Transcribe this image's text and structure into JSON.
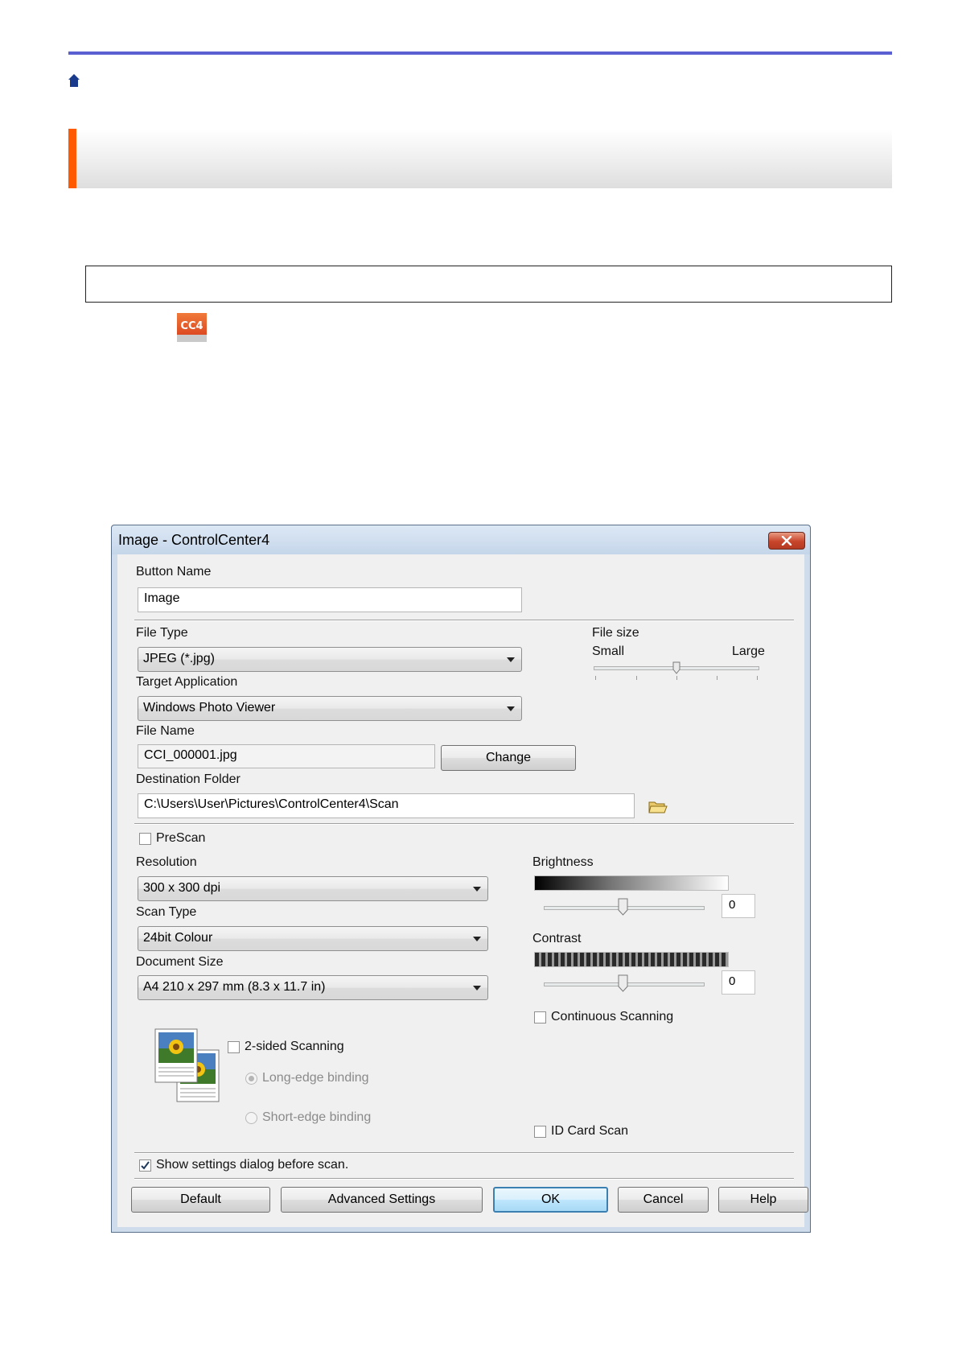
{
  "dialog": {
    "title": "Image - ControlCenter4",
    "button_name_label": "Button Name",
    "button_name_value": "Image",
    "file_type_label": "File Type",
    "file_type_value": "JPEG (*.jpg)",
    "file_size_label": "File size",
    "file_size_small": "Small",
    "file_size_large": "Large",
    "target_app_label": "Target Application",
    "target_app_value": "Windows Photo Viewer",
    "file_name_label": "File Name",
    "file_name_value": "CCI_000001.jpg",
    "change_button": "Change",
    "dest_folder_label": "Destination Folder",
    "dest_folder_value": "C:\\Users\\User\\Pictures\\ControlCenter4\\Scan",
    "prescan_label": "PreScan",
    "resolution_label": "Resolution",
    "resolution_value": "300 x 300 dpi",
    "scan_type_label": "Scan Type",
    "scan_type_value": "24bit Colour",
    "doc_size_label": "Document Size",
    "doc_size_value": "A4 210 x 297 mm (8.3 x 11.7 in)",
    "brightness_label": "Brightness",
    "brightness_value": "0",
    "contrast_label": "Contrast",
    "contrast_value": "0",
    "continuous_label": "Continuous Scanning",
    "two_sided_label": "2-sided Scanning",
    "long_edge_label": "Long-edge binding",
    "short_edge_label": "Short-edge binding",
    "id_card_label": "ID Card Scan",
    "show_settings_label": "Show settings dialog before scan.",
    "show_settings_checked": true,
    "buttons": {
      "default": "Default",
      "advanced": "Advanced Settings",
      "ok": "OK",
      "cancel": "Cancel",
      "help": "Help"
    }
  },
  "icons": {
    "cc4_label": "CC4"
  },
  "colors": {
    "page_rule": "#5a5fd2",
    "heading_accent": "#ff5a00",
    "home_icon": "#1a3a8c"
  }
}
